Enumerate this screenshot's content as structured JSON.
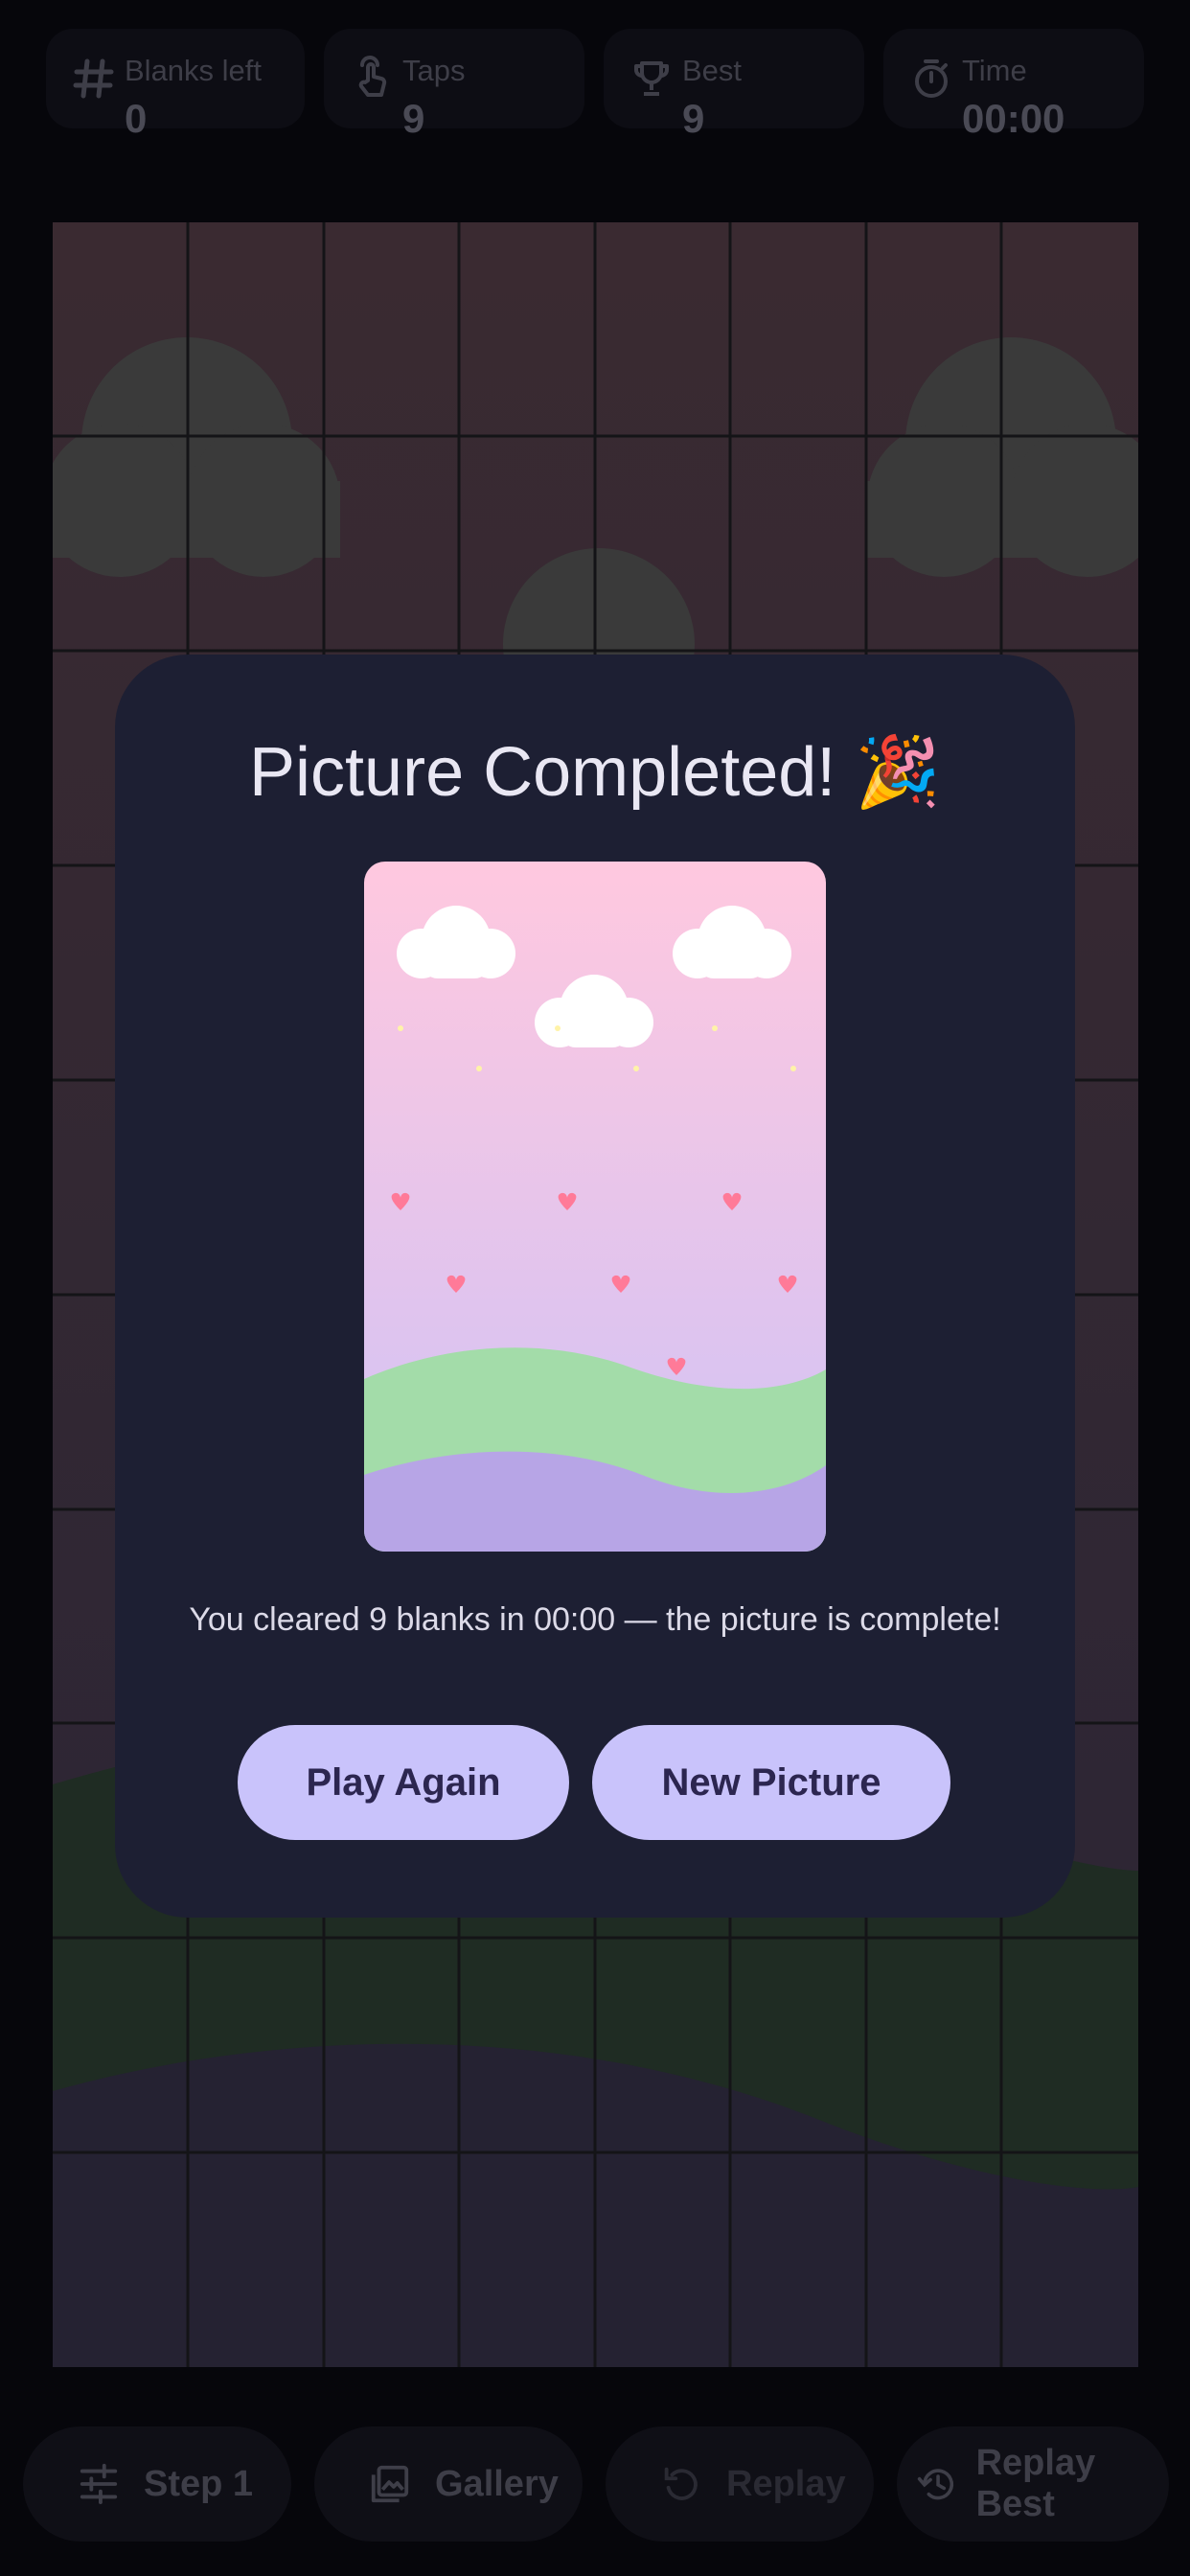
{
  "stats": {
    "blanks_left": {
      "label": "Blanks left",
      "value": "0",
      "icon": "hash-icon"
    },
    "taps": {
      "label": "Taps",
      "value": "9",
      "icon": "tap-icon"
    },
    "best": {
      "label": "Best",
      "value": "9",
      "icon": "trophy-icon"
    },
    "time": {
      "label": "Time",
      "value": "00:00",
      "icon": "stopwatch-icon"
    }
  },
  "modal": {
    "title": "Picture Completed! 🎉",
    "message": "You cleared 9 blanks in 00:00 — the picture is complete!",
    "play_again": "Play Again",
    "new_picture": "New Picture"
  },
  "toolbar": {
    "step": "Step 1",
    "gallery": "Gallery",
    "replay": "Replay",
    "replay_best": "Replay Best"
  },
  "colors": {
    "modal_bg": "#1d1f33",
    "button_bg": "#c9c3fb",
    "button_text": "#2c2650",
    "sky_top": "#ffc8df",
    "sky_bottom": "#d5c4f4",
    "hill_green": "#a3dca9",
    "hill_purple": "#b7a5e6",
    "heart": "#ff7a98"
  }
}
